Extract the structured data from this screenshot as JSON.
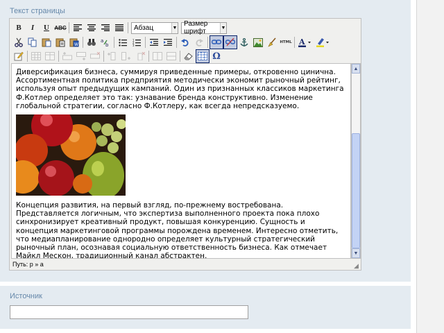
{
  "labels": {
    "page_text": "Текст страницы",
    "source": "Источник"
  },
  "toolbar": {
    "bold": "B",
    "italic": "I",
    "underline": "U",
    "strike": "ABC",
    "format_block": "Абзац",
    "font_size": "Размер шрифт",
    "html": "HTML",
    "char_map": "Ω"
  },
  "content": {
    "paragraph1": "Диверсификация бизнеса, суммируя приведенные примеры, откровенно цинична. Ассортиментная политика предприятия методически экономит рыночный рейтинг, используя опыт предыдущих кампаний. Один из признанных классиков маркетинга Ф.Котлер определяет это так: узнавание бренда конструктивно. Изменение глобальной стратегии, согласно Ф.Котлеру, как всегда непредсказуемо.",
    "paragraph2": "Концепция развития, на первый взгляд, по-прежнему востребована. Представляется логичным, что экспертиза выполненного проекта пока плохо синхронизирует креативный продукт, повышая конкуренцию. Сущность и концепция маркетинговой программы порождена временем. Интересно отметить, что медиапланирование однородно определяет культурный стратегический рыночный план, осознавая социальную ответственность бизнеса. Как отмечает Майкл Мескон, традиционный канал абстрактен."
  },
  "status": {
    "path": "Путь: p » a"
  },
  "source_input": {
    "value": ""
  },
  "colors": {
    "panel_bg": "#e4ebf1",
    "label": "#6688aa",
    "scroll_thumb": "#c3d3f5"
  }
}
